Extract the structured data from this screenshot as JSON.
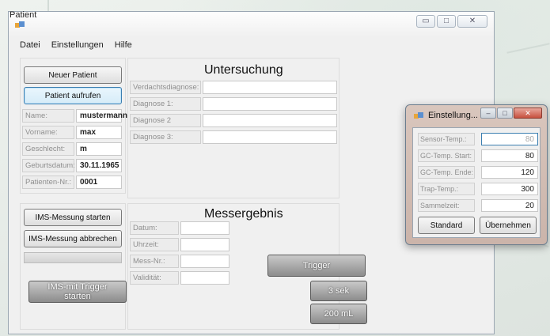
{
  "window": {
    "title": "Patient"
  },
  "menu": [
    "Datei",
    "Einstellungen",
    "Hilfe"
  ],
  "patient_panel": {
    "new_patient_btn": "Neuer Patient",
    "open_patient_btn": "Patient aufrufen",
    "fields": [
      {
        "label": "Name:",
        "value": "mustermann"
      },
      {
        "label": "Vorname:",
        "value": "max"
      },
      {
        "label": "Geschlecht:",
        "value": "m"
      },
      {
        "label": "Geburtsdatum:",
        "value": "30.11.1965"
      },
      {
        "label": "Patienten-Nr.:",
        "value": "0001"
      }
    ]
  },
  "exam_panel": {
    "heading": "Untersuchung",
    "fields": [
      {
        "label": "Verdachtsdiagnose:",
        "value": ""
      },
      {
        "label": "Diagnose 1:",
        "value": ""
      },
      {
        "label": "Diagnose 2",
        "value": ""
      },
      {
        "label": "Diagnose 3:",
        "value": ""
      }
    ]
  },
  "measure_controls": {
    "start_btn": "IMS-Messung starten",
    "abort_btn": "IMS-Messung abbrechen",
    "progress": 0,
    "trigger_start_btn": "IMS-mit Trigger starten"
  },
  "result_panel": {
    "heading": "Messergebnis",
    "fields": [
      {
        "label": "Datum:",
        "value": ""
      },
      {
        "label": "Uhrzeit:",
        "value": ""
      },
      {
        "label": "Mess-Nr.:",
        "value": ""
      },
      {
        "label": "Validität:",
        "value": ""
      }
    ],
    "trigger_btn": "Trigger",
    "seconds_btn": "3 sek",
    "volume_btn": "200 mL"
  },
  "settings_dialog": {
    "title": "Einstellung...",
    "rows": [
      {
        "label": "Sensor-Temp.:",
        "value": "80"
      },
      {
        "label": "GC-Temp. Start:",
        "value": "80"
      },
      {
        "label": "GC-Temp. Ende:",
        "value": "120"
      },
      {
        "label": "Trap-Temp.:",
        "value": "300"
      },
      {
        "label": "Sammelzeit:",
        "value": "20"
      }
    ],
    "standard_btn": "Standard",
    "apply_btn": "Übernehmen"
  }
}
